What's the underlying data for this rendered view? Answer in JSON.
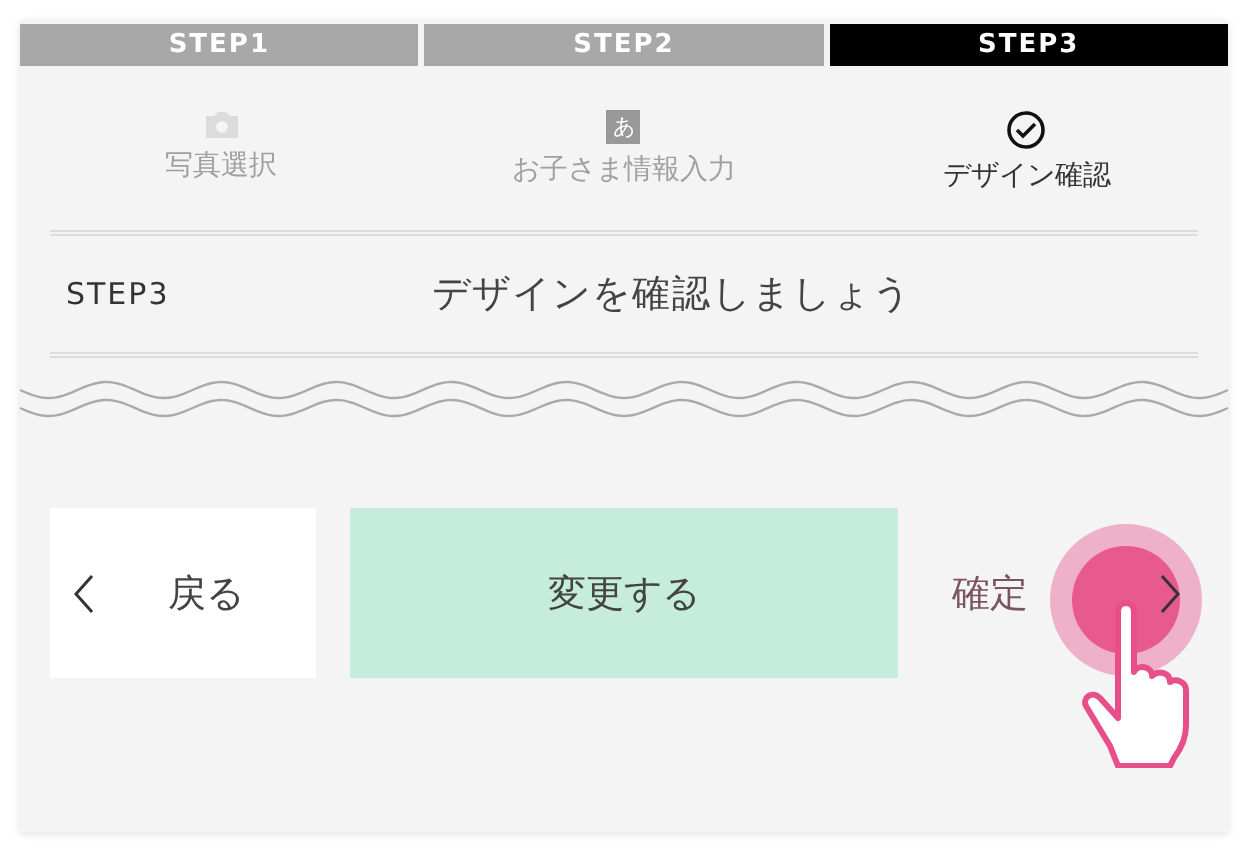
{
  "steps": [
    {
      "label": "STEP1",
      "selected": false
    },
    {
      "label": "STEP2",
      "selected": false
    },
    {
      "label": "STEP3",
      "selected": true
    }
  ],
  "step_items": [
    {
      "kind": "camera",
      "label": "写真選択",
      "active": false
    },
    {
      "kind": "glyph",
      "glyph": "あ",
      "label": "お子さま情報入力",
      "active": false
    },
    {
      "kind": "check",
      "label": "デザイン確認",
      "active": true
    }
  ],
  "heading": {
    "step": "STEP3",
    "text": "デザインを確認しましょう"
  },
  "buttons": [
    {
      "kind": "back",
      "label": "戻る"
    },
    {
      "kind": "change",
      "label": "変更する"
    },
    {
      "kind": "confirm",
      "label": "確定",
      "pressed": true
    }
  ]
}
